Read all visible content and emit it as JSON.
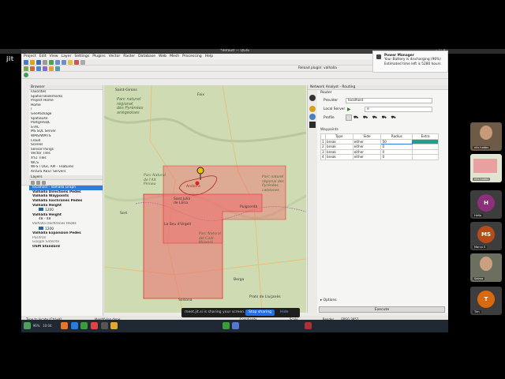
{
  "window": {
    "title": "*default — QGIS",
    "jitsi": "jit"
  },
  "menu": [
    "Project",
    "Edit",
    "View",
    "Layer",
    "Settings",
    "Plugins",
    "Vector",
    "Raster",
    "Database",
    "Web",
    "Mesh",
    "Processing",
    "Help"
  ],
  "toolbar": {
    "reload_plugin": "Reload plugin: valhalla"
  },
  "browser": {
    "title": "Browser",
    "items": [
      "Favorites",
      "Spatial Bookmarks",
      "Project Home",
      "Home",
      "/",
      "GeoPackage",
      "SpatiaLite",
      "PostgreSQL",
      "STAC",
      "MS SQL Server",
      "WMS/WMTS",
      "Cloud",
      "Scenes",
      "SensorThings",
      "Vector Tiles",
      "XYZ Tiles",
      "WCS",
      "WFS / OGC API - Features",
      "ArcGIS REST Servers"
    ]
  },
  "layers": {
    "title": "Layers",
    "items": [
      "localhost - Valhalla Graph",
      "Valhalla Directions Pedes",
      "Valhalla Waypoints",
      "Valhalla Isochrones Pedes",
      "Valhalla Height",
      "1200",
      "Valhalla Height",
      "48 - 48",
      "Valhalla Isochrones Pedes",
      "1200",
      "Valhalla Expansion Pedes",
      "Positron",
      "Google Satellite",
      "OSM Standard"
    ]
  },
  "routing": {
    "panel_title": "Network Analyst - Routing",
    "section_router": "Router",
    "provider_label": "Provider",
    "provider_value": "localhost",
    "local_server_label": "Local Server",
    "local_server_value": "e",
    "profile_label": "Profile",
    "waypoints_label": "Waypoints",
    "columns": [
      "Type",
      "Side",
      "Radius",
      "Extra"
    ],
    "rows": [
      {
        "n": "1",
        "type": "break",
        "side": "either",
        "radius": "50"
      },
      {
        "n": "2",
        "type": "break",
        "side": "either",
        "radius": "0"
      },
      {
        "n": "3",
        "type": "break",
        "side": "either",
        "radius": "0"
      },
      {
        "n": "4",
        "type": "break",
        "side": "either",
        "radius": "0"
      }
    ],
    "options_label": "Options",
    "execute_label": "Execute"
  },
  "map_labels": {
    "park1": "Parc naturel\nrégional\ndes Pyrénées\nariégeoises",
    "park2": "Parc Natural\nde l'Alt\nPirineu",
    "park3": "Parc naturel\nrégional des\nPyrénées\ncatalanes",
    "park4": "Parc Natural\ndel Cadí-\nMoixeró",
    "towns": [
      "Saint-Girons",
      "Foix",
      "Andorra",
      "Sant Julià\nde Lòria",
      "La Seu d'Urgell",
      "Puigcerdà",
      "Sort",
      "Berga",
      "Solsona",
      "Prats de Lluçanès"
    ]
  },
  "statusbar": {
    "coordinate": "Coordinate",
    "scale": "Scale",
    "render": "Render",
    "crs": "EPSG:3857",
    "left": "Type to locate (Ctrl+K)",
    "mid": "Identifying done"
  },
  "notification": {
    "title": "Power Manager",
    "line1": "Your Battery is discharging (96%)",
    "line2": "Estimated time left is 5280 hours"
  },
  "screenshare": {
    "text": "meet.jit.si is sharing your screen.",
    "stop": "Stop sharing",
    "hide": "Hide"
  },
  "taskbar": {
    "battery": "96%",
    "time": "10:04"
  },
  "participants": [
    {
      "name": "nils hobbs",
      "type": "video"
    },
    {
      "name": "nils.hobbs",
      "type": "screen"
    },
    {
      "name": "Hella",
      "initial": "H",
      "color": "#8e2f7c"
    },
    {
      "name": "Marco S",
      "initial": "MS",
      "color": "#b64b17"
    },
    {
      "name": "Selma",
      "type": "video"
    },
    {
      "name": "Tim",
      "initial": "T",
      "color": "#d9690f"
    }
  ],
  "colors": {
    "isochrone_fill": "#ee6c6c",
    "isochrone_stroke": "#d33",
    "accent": "#2f7cd8",
    "radius_cell": "#1aa28b"
  }
}
